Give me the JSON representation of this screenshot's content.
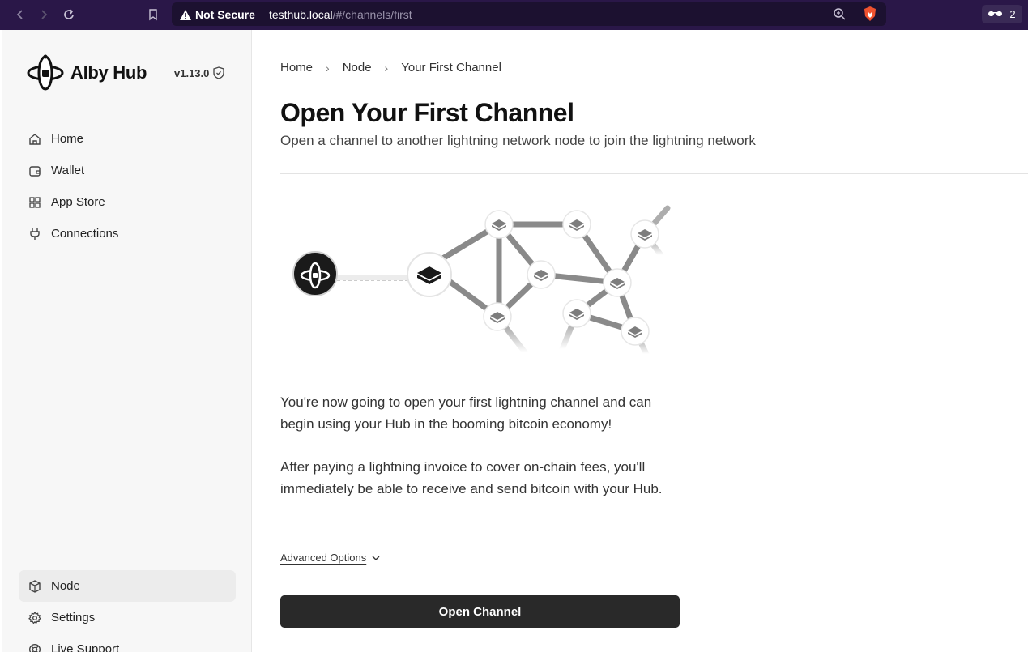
{
  "browser": {
    "security_label": "Not Secure",
    "url_host": "testhub.local",
    "url_path": "/#/channels/first",
    "extension_count": "2"
  },
  "sidebar": {
    "app_name": "Alby Hub",
    "version": "v1.13.0",
    "top_items": [
      {
        "label": "Home",
        "icon": "home-icon"
      },
      {
        "label": "Wallet",
        "icon": "wallet-icon"
      },
      {
        "label": "App Store",
        "icon": "grid-icon"
      },
      {
        "label": "Connections",
        "icon": "plug-icon"
      }
    ],
    "bottom_items": [
      {
        "label": "Node",
        "icon": "box-icon",
        "active": true
      },
      {
        "label": "Settings",
        "icon": "gear-icon"
      },
      {
        "label": "Live Support",
        "icon": "lifebuoy-icon"
      }
    ]
  },
  "main": {
    "breadcrumb": [
      "Home",
      "Node",
      "Your First Channel"
    ],
    "title": "Open Your First Channel",
    "subtitle": "Open a channel to another lightning network node to join the lightning network",
    "paragraph1": "You're now going to open your first lightning channel and can begin using your Hub in the booming bitcoin economy!",
    "paragraph2": "After paying a lightning invoice to cover on-chain fees, you'll immediately be able to receive and send bitcoin with your Hub.",
    "advanced_options_label": "Advanced Options",
    "open_channel_label": "Open Channel"
  },
  "colors": {
    "browser_chrome": "#2a1748",
    "sidebar_bg": "#f7f7f7",
    "button_bg": "#292929"
  }
}
